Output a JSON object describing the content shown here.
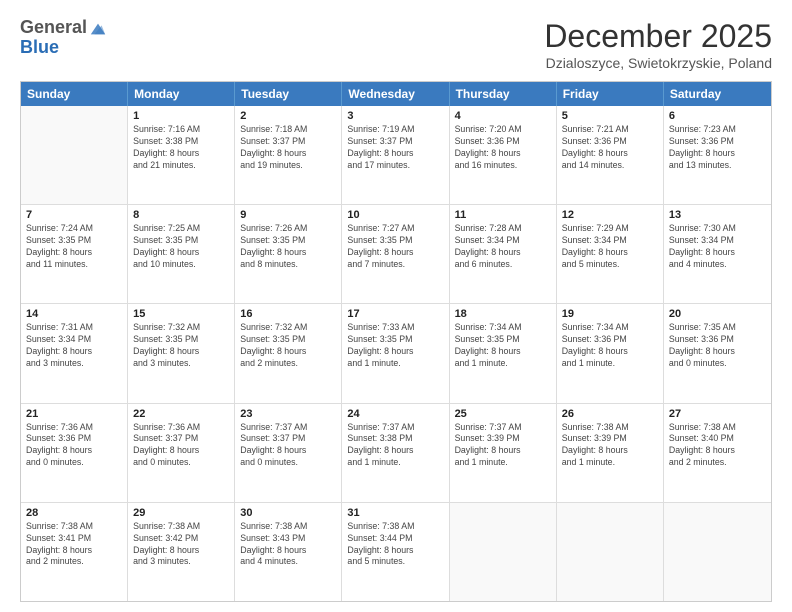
{
  "header": {
    "logo_general": "General",
    "logo_blue": "Blue",
    "month_title": "December 2025",
    "location": "Dzialoszyce, Swietokrzyskie, Poland"
  },
  "days_of_week": [
    "Sunday",
    "Monday",
    "Tuesday",
    "Wednesday",
    "Thursday",
    "Friday",
    "Saturday"
  ],
  "rows": [
    [
      {
        "day": "",
        "info": ""
      },
      {
        "day": "1",
        "info": "Sunrise: 7:16 AM\nSunset: 3:38 PM\nDaylight: 8 hours\nand 21 minutes."
      },
      {
        "day": "2",
        "info": "Sunrise: 7:18 AM\nSunset: 3:37 PM\nDaylight: 8 hours\nand 19 minutes."
      },
      {
        "day": "3",
        "info": "Sunrise: 7:19 AM\nSunset: 3:37 PM\nDaylight: 8 hours\nand 17 minutes."
      },
      {
        "day": "4",
        "info": "Sunrise: 7:20 AM\nSunset: 3:36 PM\nDaylight: 8 hours\nand 16 minutes."
      },
      {
        "day": "5",
        "info": "Sunrise: 7:21 AM\nSunset: 3:36 PM\nDaylight: 8 hours\nand 14 minutes."
      },
      {
        "day": "6",
        "info": "Sunrise: 7:23 AM\nSunset: 3:36 PM\nDaylight: 8 hours\nand 13 minutes."
      }
    ],
    [
      {
        "day": "7",
        "info": "Sunrise: 7:24 AM\nSunset: 3:35 PM\nDaylight: 8 hours\nand 11 minutes."
      },
      {
        "day": "8",
        "info": "Sunrise: 7:25 AM\nSunset: 3:35 PM\nDaylight: 8 hours\nand 10 minutes."
      },
      {
        "day": "9",
        "info": "Sunrise: 7:26 AM\nSunset: 3:35 PM\nDaylight: 8 hours\nand 8 minutes."
      },
      {
        "day": "10",
        "info": "Sunrise: 7:27 AM\nSunset: 3:35 PM\nDaylight: 8 hours\nand 7 minutes."
      },
      {
        "day": "11",
        "info": "Sunrise: 7:28 AM\nSunset: 3:34 PM\nDaylight: 8 hours\nand 6 minutes."
      },
      {
        "day": "12",
        "info": "Sunrise: 7:29 AM\nSunset: 3:34 PM\nDaylight: 8 hours\nand 5 minutes."
      },
      {
        "day": "13",
        "info": "Sunrise: 7:30 AM\nSunset: 3:34 PM\nDaylight: 8 hours\nand 4 minutes."
      }
    ],
    [
      {
        "day": "14",
        "info": "Sunrise: 7:31 AM\nSunset: 3:34 PM\nDaylight: 8 hours\nand 3 minutes."
      },
      {
        "day": "15",
        "info": "Sunrise: 7:32 AM\nSunset: 3:35 PM\nDaylight: 8 hours\nand 3 minutes."
      },
      {
        "day": "16",
        "info": "Sunrise: 7:32 AM\nSunset: 3:35 PM\nDaylight: 8 hours\nand 2 minutes."
      },
      {
        "day": "17",
        "info": "Sunrise: 7:33 AM\nSunset: 3:35 PM\nDaylight: 8 hours\nand 1 minute."
      },
      {
        "day": "18",
        "info": "Sunrise: 7:34 AM\nSunset: 3:35 PM\nDaylight: 8 hours\nand 1 minute."
      },
      {
        "day": "19",
        "info": "Sunrise: 7:34 AM\nSunset: 3:36 PM\nDaylight: 8 hours\nand 1 minute."
      },
      {
        "day": "20",
        "info": "Sunrise: 7:35 AM\nSunset: 3:36 PM\nDaylight: 8 hours\nand 0 minutes."
      }
    ],
    [
      {
        "day": "21",
        "info": "Sunrise: 7:36 AM\nSunset: 3:36 PM\nDaylight: 8 hours\nand 0 minutes."
      },
      {
        "day": "22",
        "info": "Sunrise: 7:36 AM\nSunset: 3:37 PM\nDaylight: 8 hours\nand 0 minutes."
      },
      {
        "day": "23",
        "info": "Sunrise: 7:37 AM\nSunset: 3:37 PM\nDaylight: 8 hours\nand 0 minutes."
      },
      {
        "day": "24",
        "info": "Sunrise: 7:37 AM\nSunset: 3:38 PM\nDaylight: 8 hours\nand 1 minute."
      },
      {
        "day": "25",
        "info": "Sunrise: 7:37 AM\nSunset: 3:39 PM\nDaylight: 8 hours\nand 1 minute."
      },
      {
        "day": "26",
        "info": "Sunrise: 7:38 AM\nSunset: 3:39 PM\nDaylight: 8 hours\nand 1 minute."
      },
      {
        "day": "27",
        "info": "Sunrise: 7:38 AM\nSunset: 3:40 PM\nDaylight: 8 hours\nand 2 minutes."
      }
    ],
    [
      {
        "day": "28",
        "info": "Sunrise: 7:38 AM\nSunset: 3:41 PM\nDaylight: 8 hours\nand 2 minutes."
      },
      {
        "day": "29",
        "info": "Sunrise: 7:38 AM\nSunset: 3:42 PM\nDaylight: 8 hours\nand 3 minutes."
      },
      {
        "day": "30",
        "info": "Sunrise: 7:38 AM\nSunset: 3:43 PM\nDaylight: 8 hours\nand 4 minutes."
      },
      {
        "day": "31",
        "info": "Sunrise: 7:38 AM\nSunset: 3:44 PM\nDaylight: 8 hours\nand 5 minutes."
      },
      {
        "day": "",
        "info": ""
      },
      {
        "day": "",
        "info": ""
      },
      {
        "day": "",
        "info": ""
      }
    ]
  ]
}
